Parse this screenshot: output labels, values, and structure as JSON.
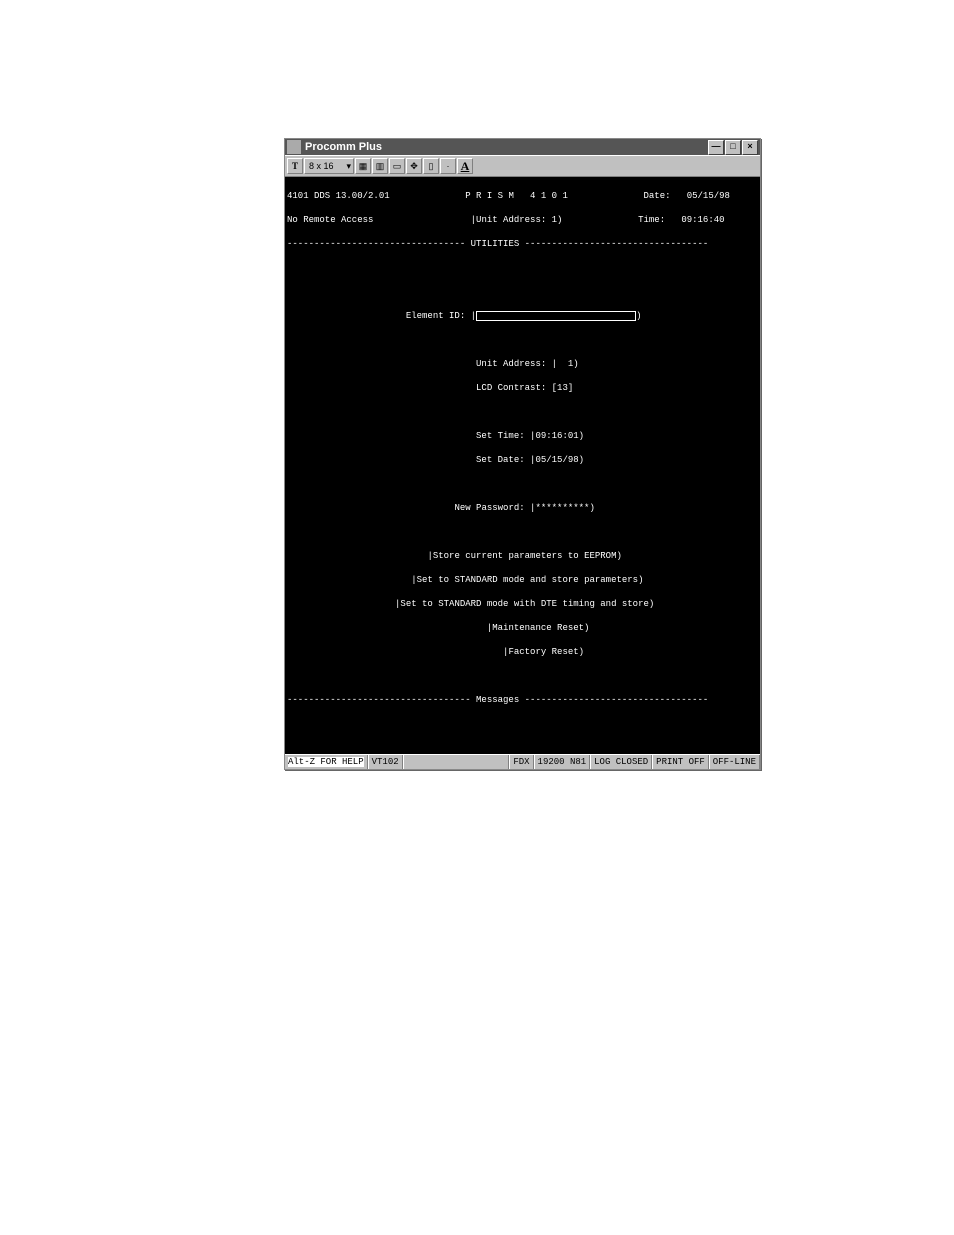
{
  "window": {
    "title": "Procomm Plus",
    "controls": {
      "min": "—",
      "max": "□",
      "close": "×"
    }
  },
  "toolbar": {
    "font_label": "8 x 16",
    "letter_label": "A",
    "icons": [
      "tt-icon",
      "grid1-icon",
      "grid2-icon",
      "page-icon",
      "arrows-icon",
      "clipboard-icon",
      "spark-icon"
    ]
  },
  "terminal": {
    "line1_left": "4101 DDS 13.00/2.01",
    "line1_center": "P R I S M   4 1 0 1",
    "line1_date_lbl": "Date:",
    "line1_date": "05/15/98",
    "line2_left": "No Remote Access",
    "line2_center": "|Unit Address: 1)",
    "line2_time_lbl": "Time:",
    "line2_time": "09:16:40",
    "section1": "UTILITIES",
    "element_id_lbl": "Element ID:",
    "element_id_val": "|",
    "element_id_close": ")",
    "unit_address": "Unit Address: |  1)",
    "lcd_contrast": "LCD Contrast: [13]",
    "set_time": "Set Time: |09:16:01)",
    "set_date": "Set Date: |05/15/98)",
    "new_password": "New Password: |**********)",
    "act1": "|Store current parameters to EEPROM)",
    "act2": "|Set to STANDARD mode and store parameters)",
    "act3": "|Set to STANDARD mode with DTE timing and store)",
    "act4": "|Maintenance Reset)",
    "act5": "|Factory Reset)",
    "section2": "Messages"
  },
  "statusbar": {
    "help": "Alt-Z FOR HELP",
    "term": "VT102",
    "duplex": "FDX",
    "port": "19200 N81",
    "log": "LOG CLOSED",
    "print": "PRINT OFF",
    "line": "OFF-LINE"
  }
}
